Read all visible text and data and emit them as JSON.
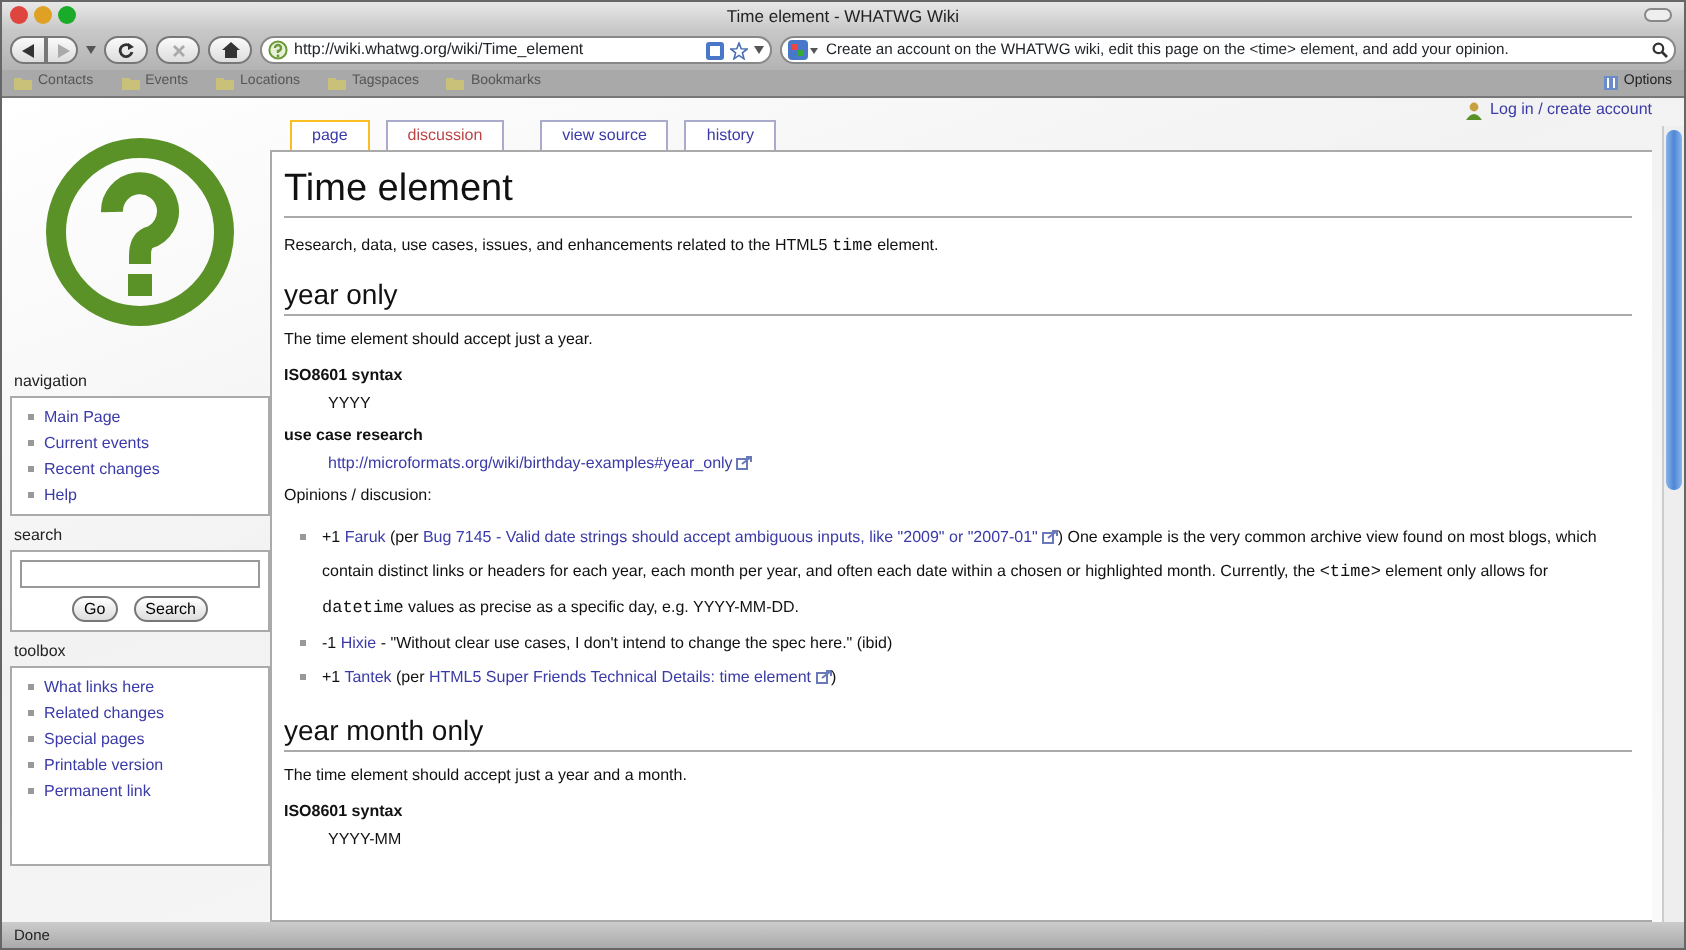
{
  "window": {
    "title": "Time element - WHATWG Wiki"
  },
  "toolbar": {
    "url": "http://wiki.whatwg.org/wiki/Time_element",
    "search_text": "Create an account on the WHATWG wiki, edit this page on the <time> element, and add your opinion."
  },
  "bookmarks": [
    "Contacts",
    "Events",
    "Locations",
    "Tagspaces",
    "Bookmarks"
  ],
  "bookmarks_options": "Options",
  "tabs": [
    {
      "label": "page",
      "selected": true
    },
    {
      "label": "discussion",
      "selected": false
    },
    {
      "label": "view source",
      "selected": false
    },
    {
      "label": "history",
      "selected": false
    }
  ],
  "login": "Log in / create account",
  "sidebar": {
    "navigation": {
      "title": "navigation",
      "items": [
        "Main Page",
        "Current events",
        "Recent changes",
        "Help"
      ]
    },
    "search": {
      "title": "search",
      "buttons": [
        "Go",
        "Search"
      ]
    },
    "toolbox": {
      "title": "toolbox",
      "items": [
        "What links here",
        "Related changes",
        "Special pages",
        "Printable version",
        "Permanent link"
      ]
    }
  },
  "article": {
    "title": "Time element",
    "blocks": [
      {
        "kind": "p",
        "segments": [
          {
            "kind": "text",
            "text": "Research, data, use cases, issues, and enhancements related to the HTML5 "
          },
          {
            "kind": "code",
            "text": "time"
          },
          {
            "kind": "text",
            "text": " element."
          }
        ]
      },
      {
        "kind": "heading",
        "text": "year only"
      },
      {
        "kind": "p",
        "segments": [
          {
            "kind": "text",
            "text": "The time element should accept just a year."
          }
        ]
      },
      {
        "kind": "term",
        "text": "ISO8601 syntax"
      },
      {
        "kind": "def",
        "segments": [
          {
            "kind": "text",
            "text": "YYYY"
          }
        ]
      },
      {
        "kind": "term",
        "text": "use case research"
      },
      {
        "kind": "def",
        "segments": [
          {
            "kind": "extlink",
            "text": "http://microformats.org/wiki/birthday-examples#year_only"
          }
        ]
      },
      {
        "kind": "p",
        "segments": [
          {
            "kind": "text",
            "text": "Opinions / discusion:"
          }
        ]
      },
      {
        "kind": "list",
        "items": [
          [
            {
              "kind": "text",
              "text": "+1 "
            },
            {
              "kind": "link",
              "text": "Faruk"
            },
            {
              "kind": "text",
              "text": " (per "
            },
            {
              "kind": "extlink",
              "text": "Bug 7145 - Valid date strings should accept ambiguous inputs, like \"2009\" or \"2007-01\""
            },
            {
              "kind": "text",
              "text": ") One example is the very common archive view found on most blogs, which contain distinct links or headers for each year, each month per year, and often each date within a chosen or highlighted month. Currently, the "
            },
            {
              "kind": "code",
              "text": "<time>"
            },
            {
              "kind": "text",
              "text": " element only allows for "
            },
            {
              "kind": "code",
              "text": "datetime"
            },
            {
              "kind": "text",
              "text": " values as precise as a specific day, e.g. YYYY-MM-DD."
            }
          ],
          [
            {
              "kind": "text",
              "text": "-1 "
            },
            {
              "kind": "link",
              "text": "Hixie"
            },
            {
              "kind": "text",
              "text": " - \"Without clear use cases, I don't intend to change the spec here.\" (ibid)"
            }
          ],
          [
            {
              "kind": "text",
              "text": "+1 "
            },
            {
              "kind": "link",
              "text": "Tantek"
            },
            {
              "kind": "text",
              "text": " (per "
            },
            {
              "kind": "extlink",
              "text": "HTML5 Super Friends Technical Details: time element"
            },
            {
              "kind": "text",
              "text": ")"
            }
          ]
        ]
      },
      {
        "kind": "heading",
        "text": "year month only"
      },
      {
        "kind": "p",
        "segments": [
          {
            "kind": "text",
            "text": "The time element should accept just a year and a month."
          }
        ]
      },
      {
        "kind": "term",
        "text": "ISO8601 syntax"
      },
      {
        "kind": "def",
        "segments": [
          {
            "kind": "text",
            "text": "YYYY-MM"
          }
        ]
      }
    ]
  },
  "status_bar": {
    "text": "Done"
  }
}
